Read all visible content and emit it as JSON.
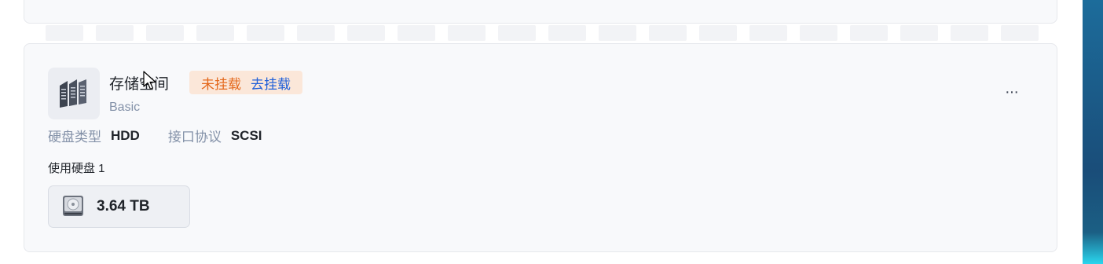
{
  "storage_pool": {
    "title": "存储空间",
    "status": "未挂载",
    "action": "去挂载",
    "raid_type": "Basic",
    "disk_type_label": "硬盘类型",
    "disk_type_value": "HDD",
    "protocol_label": "接口协议",
    "protocol_value": "SCSI",
    "used_disks_label": "使用硬盘 1",
    "disk": {
      "size": "3.64 TB"
    },
    "more_label": "···"
  },
  "icons": {
    "pool": "disk-array-icon",
    "disk": "hard-drive-icon",
    "more": "more-icon",
    "cursor": "mouse-cursor-icon"
  },
  "colors": {
    "status_text": "#e4681c",
    "status_bg": "#fbe7d9",
    "link": "#1f5fd9",
    "label": "#8391a8"
  }
}
